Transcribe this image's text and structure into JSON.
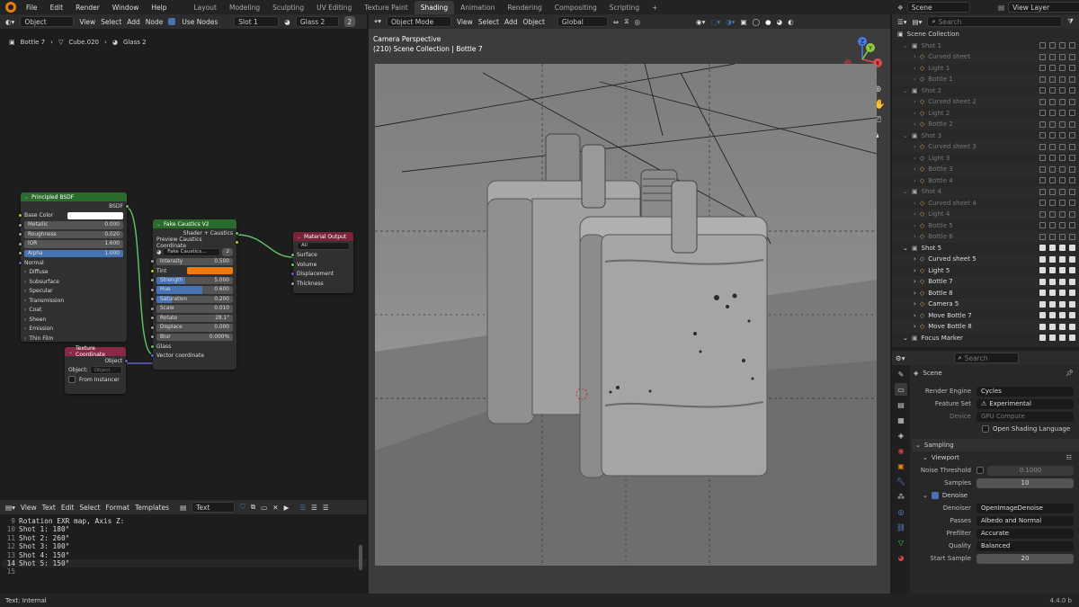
{
  "topbar": {
    "menus": [
      "File",
      "Edit",
      "Render",
      "Window",
      "Help"
    ],
    "workspaces": [
      "Layout",
      "Modeling",
      "Sculpting",
      "UV Editing",
      "Texture Paint",
      "Shading",
      "Animation",
      "Rendering",
      "Compositing",
      "Scripting"
    ],
    "active_workspace": "Shading",
    "add_tab": "+",
    "scene": "Scene",
    "view_layer": "View Layer"
  },
  "node_editor": {
    "mode": "Object",
    "menus": [
      "View",
      "Select",
      "Add",
      "Node"
    ],
    "use_nodes": "Use Nodes",
    "slot": "Slot 1",
    "material": "Glass 2",
    "users": "2",
    "breadcrumb": [
      "Bottle 7",
      "Cube.020",
      "Glass 2"
    ],
    "principled": {
      "title": "Principled BSDF",
      "output": "BSDF",
      "base_color": "Base Color",
      "fields": [
        {
          "label": "Metallic",
          "value": "0.000"
        },
        {
          "label": "Roughness",
          "value": "0.020"
        },
        {
          "label": "IOR",
          "value": "1.600"
        },
        {
          "label": "Alpha",
          "value": "1.000"
        }
      ],
      "normal": "Normal",
      "panels": [
        "Diffuse",
        "Subsurface",
        "Specular",
        "Transmission",
        "Coat",
        "Sheen",
        "Emission",
        "Thin Film"
      ]
    },
    "texcoord": {
      "title": "Texture Coordinate",
      "output": "Object",
      "object_label": "Object:",
      "object_placeholder": "Object",
      "from_instancer": "From Instancer"
    },
    "fake": {
      "title": "Fake Caustics V2",
      "out1": "Shader + Caustics",
      "out2": "Preview Caustics Coordinate",
      "group": "Fake Caustics...",
      "group_users": "2",
      "fields": [
        {
          "label": "Intensity",
          "value": "0.500"
        },
        {
          "label": "Tint",
          "value": ""
        },
        {
          "label": "Strength",
          "value": "5.000"
        },
        {
          "label": "Hue",
          "value": "0.600"
        },
        {
          "label": "Saturation",
          "value": "0.200"
        },
        {
          "label": "Scale",
          "value": "0.010"
        },
        {
          "label": "Rotate",
          "value": "28.1°"
        },
        {
          "label": "Displace",
          "value": "0.000"
        },
        {
          "label": "Blur",
          "value": "0.000%"
        }
      ],
      "glass": "Glass",
      "vector": "Vector coordinate",
      "tint_color": "#f27a0c"
    },
    "matout": {
      "title": "Material Output",
      "target": "All",
      "inputs": [
        "Surface",
        "Volume",
        "Displacement",
        "Thickness"
      ]
    }
  },
  "viewport": {
    "mode": "Object Mode",
    "menus": [
      "View",
      "Select",
      "Add",
      "Object"
    ],
    "orientation": "Global",
    "camera": "Camera Perspective",
    "collection_info": "(210) Scene Collection | Bottle 7",
    "gizmo": {
      "x": "X",
      "y": "Y",
      "z": "Z"
    }
  },
  "text_editor": {
    "menus": [
      "View",
      "Text",
      "Edit",
      "Select",
      "Format",
      "Templates"
    ],
    "text_name": "Text",
    "lines": [
      {
        "num": "9",
        "text": "Rotation EXR map, Axis Z:"
      },
      {
        "num": "10",
        "text": "Shot 1: 180°"
      },
      {
        "num": "11",
        "text": "Shot 2: 260°"
      },
      {
        "num": "12",
        "text": "Shot 3: 100°"
      },
      {
        "num": "13",
        "text": "Shot 4: 150°"
      },
      {
        "num": "14",
        "text": "Shot 5: 150°"
      },
      {
        "num": "15",
        "text": ""
      }
    ],
    "status": "Text: Internal"
  },
  "outliner": {
    "search_placeholder": "Search",
    "root": "Scene Collection",
    "rows": [
      {
        "label": "Shot 1",
        "level": 1,
        "dim": true
      },
      {
        "label": "Curved sheet",
        "level": 2,
        "dim": true
      },
      {
        "label": "Light 1",
        "level": 2,
        "dim": true
      },
      {
        "label": "Bottle 1",
        "level": 2,
        "dim": true
      },
      {
        "label": "Shot 2",
        "level": 1,
        "dim": true
      },
      {
        "label": "Curved sheet 2",
        "level": 2,
        "dim": true
      },
      {
        "label": "Light 2",
        "level": 2,
        "dim": true
      },
      {
        "label": "Bottle 2",
        "level": 2,
        "dim": true
      },
      {
        "label": "Shot 3",
        "level": 1,
        "dim": true
      },
      {
        "label": "Curved sheet 3",
        "level": 2,
        "dim": true
      },
      {
        "label": "Light 3",
        "level": 2,
        "dim": true
      },
      {
        "label": "Bottle 3",
        "level": 2,
        "dim": true
      },
      {
        "label": "Bottle 4",
        "level": 2,
        "dim": true
      },
      {
        "label": "Shot 4",
        "level": 1,
        "dim": true
      },
      {
        "label": "Curved sheet 4",
        "level": 2,
        "dim": true
      },
      {
        "label": "Light 4",
        "level": 2,
        "dim": true
      },
      {
        "label": "Bottle 5",
        "level": 2,
        "dim": true
      },
      {
        "label": "Bottle 6",
        "level": 2,
        "dim": true
      },
      {
        "label": "Shot 5",
        "level": 1,
        "dim": false
      },
      {
        "label": "Curved sheet 5",
        "level": 2,
        "dim": false
      },
      {
        "label": "Light 5",
        "level": 2,
        "dim": false
      },
      {
        "label": "Bottle 7",
        "level": 2,
        "dim": false
      },
      {
        "label": "Bottle 8",
        "level": 2,
        "dim": false
      },
      {
        "label": "Camera 5",
        "level": 2,
        "dim": false
      },
      {
        "label": "Move Bottle 7",
        "level": 2,
        "dim": false
      },
      {
        "label": "Move Bottle 8",
        "level": 2,
        "dim": false
      },
      {
        "label": "Focus Marker",
        "level": 1,
        "dim": false
      }
    ]
  },
  "properties": {
    "search_placeholder": "Search",
    "context": "Scene",
    "render_engine_label": "Render Engine",
    "render_engine": "Cycles",
    "feature_set_label": "Feature Set",
    "feature_set": "Experimental",
    "device_label": "Device",
    "device": "GPU Compute",
    "osl": "Open Shading Language",
    "sampling": "Sampling",
    "viewport_panel": "Viewport",
    "noise_label": "Noise Threshold",
    "noise": "0.1000",
    "samples_label": "Samples",
    "samples": "10",
    "denoise": "Denoise",
    "denoiser_label": "Denoiser",
    "denoiser": "OpenImageDenoise",
    "passes_label": "Passes",
    "passes": "Albedo and Normal",
    "prefilter_label": "Prefilter",
    "prefilter": "Accurate",
    "quality_label": "Quality",
    "quality": "Balanced",
    "start_sample_label": "Start Sample",
    "start_sample": "20"
  },
  "statusbar": {
    "version": "4.4.0 b"
  }
}
